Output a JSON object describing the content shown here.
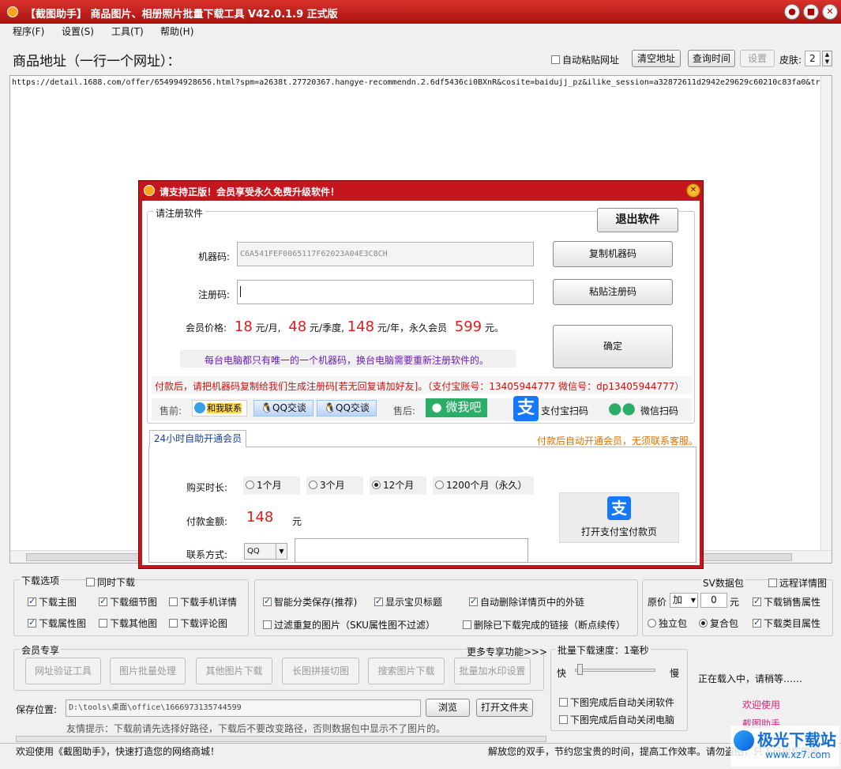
{
  "window": {
    "title": "【截图助手】 商品图片、相册照片批量下载工具 V42.0.1.9 正式版",
    "min": "●",
    "max": "■",
    "close": "✕"
  },
  "menu": [
    "程序(F)",
    "设置(S)",
    "工具(T)",
    "帮助(H)"
  ],
  "header": {
    "label": "商品地址（一行一个网址）：",
    "auto_paste": "自动粘贴网址",
    "clear": "清空地址",
    "query_time": "查询时间",
    "settings": "设置",
    "skin_label": "皮肤:",
    "skin_value": "2"
  },
  "url_text": "https://detail.1688.com/offer/654994928656.html?spm=a2638t.27720367.hangye-recommendn.2.6df5436ci0BXnR&cosite=baidujj_pz&ilike_session=a32872611d2942e29629c60210c83fa0&trac",
  "dialog": {
    "title": "请支持正版！会员享受永久免费升级软件！",
    "register_group": "请注册软件",
    "exit": "退出软件",
    "machine_label": "机器码:",
    "machine_code": "C6A541FEF0065117F62023A04E3C8CH",
    "copy_machine": "复制机器码",
    "reg_label": "注册码:",
    "reg_value": "",
    "paste_reg": "粘贴注册码",
    "price_label": "会员价格:",
    "price_month": "18",
    "unit_month": "元/月,",
    "price_quarter": "48",
    "unit_quarter": "元/季度,",
    "price_year": "148",
    "unit_year": "元/年，永久会员",
    "price_forever": "599",
    "unit_forever": "元。",
    "confirm": "确定",
    "note_machine": "每台电脑都只有唯一的一个机器码，换台电脑需要重新注册软件的。",
    "note_pay": "付款后，请把机器码复制给我们生成注册码[若无回复请加好友]。（支付宝账号：13405944777   微信号：dp13405944777）",
    "presale": "售前:",
    "contact_me": "和我联系",
    "qq1": "QQ交谈",
    "qq2": "QQ交谈",
    "aftersale": "售后:",
    "weiwoba": "微我吧",
    "alipay_scan": "支付宝扫码",
    "wechat_scan": "微信扫码",
    "tab": "24小时自助开通会员",
    "auto_open": "付款后自动开通会员，无须联系客服。",
    "duration_label": "购买时长:",
    "durations": [
      "1个月",
      "3个月",
      "12个月",
      "1200个月（永久）"
    ],
    "amount_label": "付款金额:",
    "amount": "148",
    "amount_unit": "元",
    "contact_label": "联系方式:",
    "contact_type": "QQ",
    "contact_value": "",
    "open_alipay": "打开支付宝付款页",
    "alipay_glyph": "支"
  },
  "download_options": {
    "title": "下载选项",
    "sync": "同时下载",
    "items": [
      "下载主图",
      "下载细节图",
      "下载手机详情",
      "下载属性图",
      "下载其他图",
      "下载评论图"
    ],
    "mid": [
      "智能分类保存(推荐)",
      "显示宝贝标题",
      "自动删除详情页中的外链",
      "过滤重复的图片（SKU属性图不过滤）",
      "删除已下载完成的链接（断点续传）"
    ],
    "csv": "SV数据包",
    "remote": "远程详情图",
    "orig_price": "原价",
    "add": "加",
    "add_value": "0",
    "yuan": "元",
    "sales_attr": "下载销售属性",
    "standalone": "独立包",
    "composite": "复合包",
    "category_attr": "下载类目属性"
  },
  "member": {
    "title": "会员专享",
    "more": "更多专享功能>>>",
    "buttons": [
      "网址验证工具",
      "图片批量处理",
      "其他图片下载",
      "长图拼接切图",
      "搜索图片下载",
      "批量加水印设置"
    ]
  },
  "speed": {
    "title": "批量下载速度：1毫秒",
    "fast": "快",
    "slow": "慢",
    "close_software": "下图完成后自动关闭软件",
    "close_pc": "下图完成后自动关闭电脑"
  },
  "status": {
    "loading": "正在载入中，请稍等……",
    "welcome1": "欢迎使用",
    "welcome2": "截图助手"
  },
  "save": {
    "label": "保存位置:",
    "path": "D:\\tools\\桌面\\office\\1666973135744599",
    "browse": "浏览",
    "open_folder": "打开文件夹",
    "tip": "友情提示：下载前请先选择好路径，下载后不要改变路径，否则数据包中显示不了图片的。"
  },
  "statusbar": {
    "left": "欢迎使用《截图助手》，快速打造您的网络商城！",
    "right": "解放您的双手，节约您宝贵的时间，提高工作效率。请勿盗图，只下已授权的图。"
  },
  "watermark": {
    "cn": "极光下载站",
    "en": "www.xz7.com"
  },
  "colors": {
    "title_red": "#c4161c",
    "price_red": "#e21b1b",
    "note_purple": "#6a1fb0",
    "tab_orange": "#e07000",
    "pay_red": "#d01010",
    "alipay_blue": "#1677ff",
    "wechat_green": "#2aae67"
  }
}
